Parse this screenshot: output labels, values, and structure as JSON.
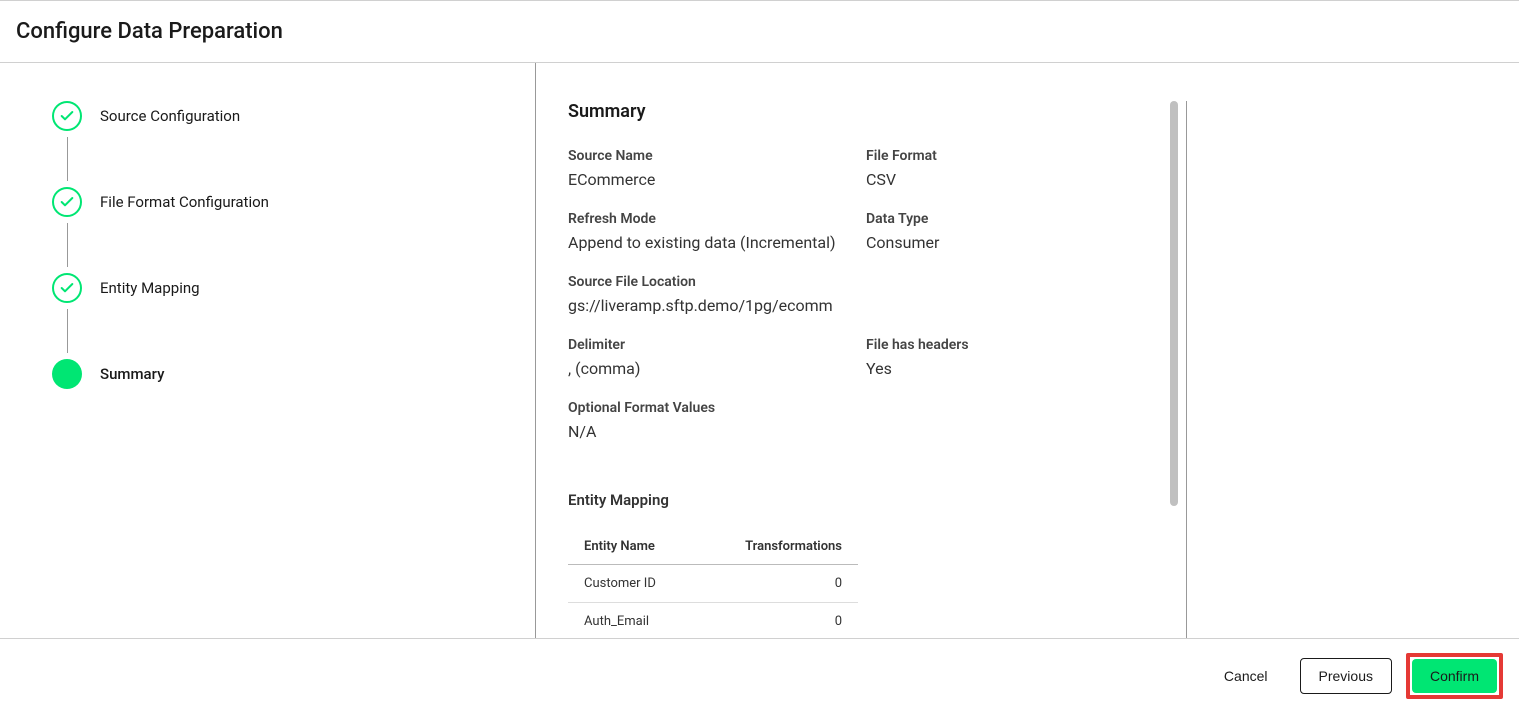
{
  "header": {
    "title": "Configure Data Preparation"
  },
  "steps": [
    {
      "label": "Source Configuration",
      "state": "complete"
    },
    {
      "label": "File Format Configuration",
      "state": "complete"
    },
    {
      "label": "Entity Mapping",
      "state": "complete"
    },
    {
      "label": "Summary",
      "state": "active"
    }
  ],
  "summary": {
    "title": "Summary",
    "fields": {
      "source_name": {
        "label": "Source Name",
        "value": "ECommerce"
      },
      "file_format": {
        "label": "File Format",
        "value": "CSV"
      },
      "refresh_mode": {
        "label": "Refresh Mode",
        "value": "Append to existing data (Incremental)"
      },
      "data_type": {
        "label": "Data Type",
        "value": "Consumer"
      },
      "source_file_location": {
        "label": "Source File Location",
        "value": "gs://liveramp.sftp.demo/1pg/ecomm"
      },
      "delimiter": {
        "label": "Delimiter",
        "value": ", (comma)"
      },
      "file_has_headers": {
        "label": "File has headers",
        "value": "Yes"
      },
      "optional_format_values": {
        "label": "Optional Format Values",
        "value": "N/A"
      }
    },
    "entity_mapping": {
      "title": "Entity Mapping",
      "columns": {
        "name": "Entity Name",
        "transformations": "Transformations"
      },
      "rows": [
        {
          "name": "Customer ID",
          "transformations": "0"
        },
        {
          "name": "Auth_Email",
          "transformations": "0"
        }
      ]
    }
  },
  "footer": {
    "cancel": "Cancel",
    "previous": "Previous",
    "confirm": "Confirm"
  }
}
